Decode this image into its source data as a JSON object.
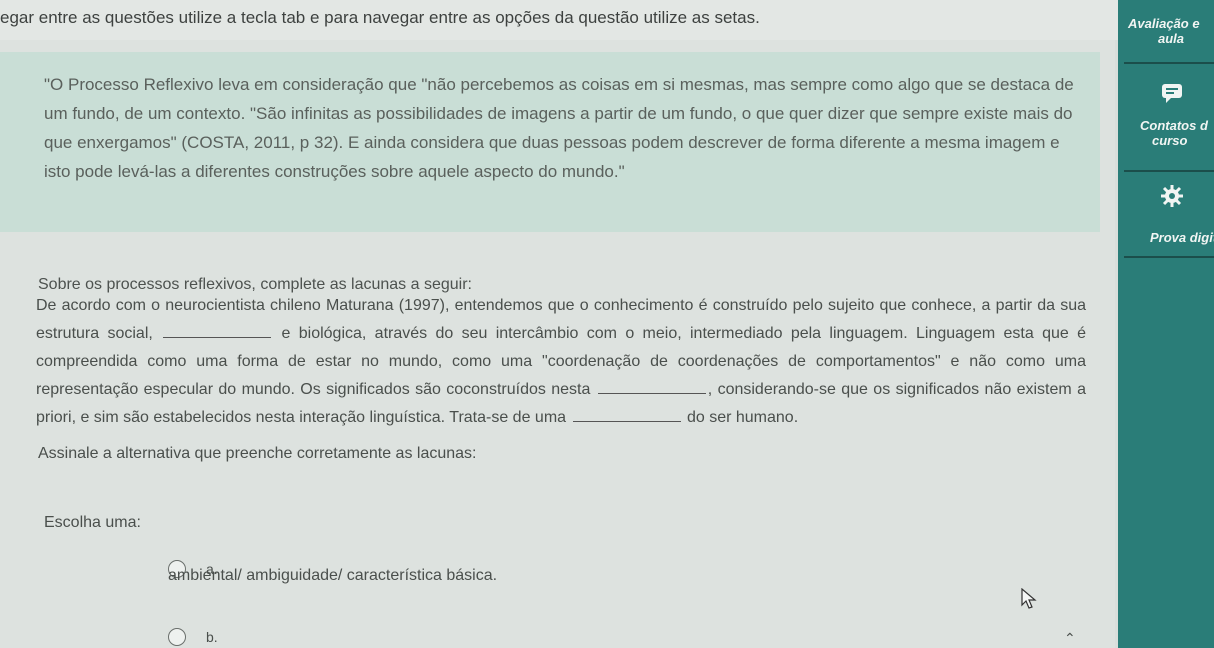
{
  "top_instruction": "egar entre as questões utilize a tecla tab e para navegar entre as opções da questão utilize as setas.",
  "quote": "\"O Processo Reflexivo leva em consideração que \"não percebemos as coisas em si mesmas, mas sempre como algo que se destaca de um fundo, de um contexto. \"São infinitas as possibilidades de imagens a partir de um fundo, o que quer dizer que sempre existe mais do que enxergamos\" (COSTA, 2011, p 32). E ainda considera que duas pessoas podem descrever de forma diferente a mesma imagem e isto pode levá-las a diferentes construções sobre aquele aspecto do mundo.\"",
  "prompt": "Sobre os processos reflexivos, complete as lacunas a seguir:",
  "body": {
    "part1": "De acordo com o neurocientista chileno Maturana (1997), entendemos que o conhecimento é construído pelo sujeito que conhece, a partir da sua estrutura social,",
    "part2": "e biológica, através do seu intercâmbio com o meio, intermediado pela linguagem. Linguagem esta que é compreendida como uma forma de estar no mundo, como uma \"coordenação de coordenações de comportamentos\" e não como uma representação especular do mundo. Os significados são coconstruídos nesta",
    "part3": ", considerando-se que os significados não existem a priori, e sim são estabelecidos nesta interação linguística. Trata-se de uma",
    "part4": "do ser humano."
  },
  "instruction": "Assinale a alternativa que preenche corretamente as lacunas:",
  "choose_label": "Escolha uma:",
  "options": [
    {
      "letter": "a.",
      "text": "ambiental/ ambiguidade/ característica básica."
    },
    {
      "letter": "b.",
      "text": ""
    }
  ],
  "sidebar": {
    "item1_line1": "Avaliação e",
    "item1_line2": "aula",
    "item2_line1": "Contatos d",
    "item2_line2": "curso",
    "item3": "Prova digit"
  },
  "icons": {
    "contacts": "chat-bubble-icon",
    "exam": "gear-icon",
    "cursor": "mouse-cursor-icon",
    "scroll": "chevron-up-icon"
  },
  "colors": {
    "sidebar": "#2a7d78",
    "quote_bg": "#c9ded6",
    "page_bg": "#dde2df"
  }
}
